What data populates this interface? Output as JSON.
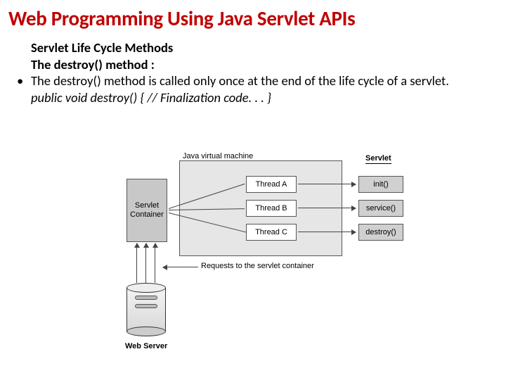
{
  "title": "Web Programming Using Java Servlet APIs",
  "heading1": "Servlet Life Cycle Methods",
  "heading2": "The destroy() method :",
  "bullet": "The destroy() method is called only once at the end of the life cycle of a servlet.",
  "code": "public void destroy() { // Finalization code. . . }",
  "diagram": {
    "jvm": "Java virtual machine",
    "container": "Servlet Container",
    "threadA": "Thread A",
    "threadB": "Thread B",
    "threadC": "Thread C",
    "servletLabel": "Servlet",
    "init": "init()",
    "service": "service()",
    "destroy": "destroy()",
    "requests": "Requests to the servlet container",
    "webServer": "Web Server"
  }
}
